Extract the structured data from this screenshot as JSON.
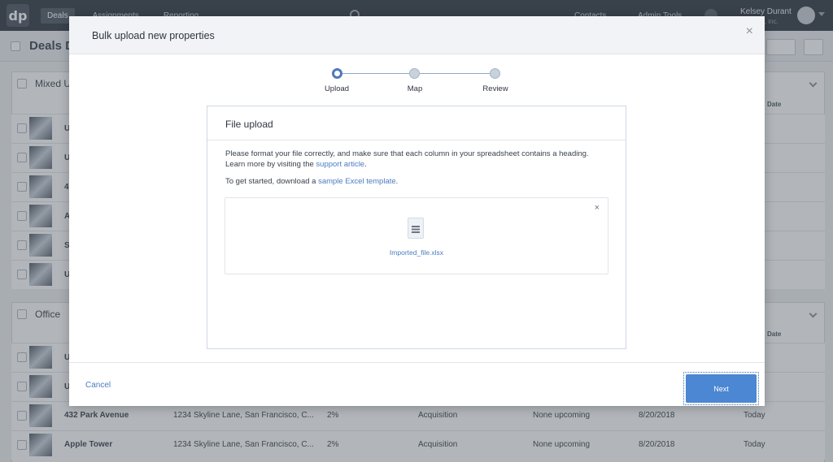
{
  "app": {
    "logo": "dp",
    "nav": [
      "Deals",
      "Assignments",
      "Reporting"
    ],
    "top_links": [
      "Contacts",
      "Admin Tools"
    ],
    "user": {
      "name": "Kelsey Durant",
      "org": "...ath, inc."
    },
    "page_title": "Deals D..."
  },
  "sections": [
    {
      "title": "Mixed U...",
      "col_date": "Date",
      "rows": [
        {
          "name": "U",
          "address": "",
          "pct": "",
          "type": "",
          "upcoming": "",
          "date": "",
          "updated": ""
        },
        {
          "name": "U",
          "address": "",
          "pct": "",
          "type": "",
          "upcoming": "",
          "date": "",
          "updated": ""
        },
        {
          "name": "4",
          "address": "",
          "pct": "",
          "type": "",
          "upcoming": "",
          "date": "",
          "updated": ""
        },
        {
          "name": "A",
          "address": "",
          "pct": "",
          "type": "",
          "upcoming": "",
          "date": "",
          "updated": ""
        },
        {
          "name": "S",
          "address": "",
          "pct": "",
          "type": "",
          "upcoming": "",
          "date": "",
          "updated": ""
        },
        {
          "name": "U",
          "address": "",
          "pct": "",
          "type": "",
          "upcoming": "",
          "date": "",
          "updated": ""
        }
      ]
    },
    {
      "title": "Office",
      "col_date": "Date",
      "rows": [
        {
          "name": "U",
          "address": "",
          "pct": "",
          "type": "",
          "upcoming": "",
          "date": "",
          "updated": ""
        },
        {
          "name": "U",
          "address": "",
          "pct": "",
          "type": "",
          "upcoming": "",
          "date": "",
          "updated": ""
        },
        {
          "name": "432 Park Avenue",
          "address": "1234 Skyline Lane, San Francisco, C...",
          "pct": "2%",
          "type": "Acquisition",
          "upcoming": "None upcoming",
          "date": "8/20/2018",
          "updated": "Today"
        },
        {
          "name": "Apple Tower",
          "address": "1234 Skyline Lane, San Francisco, C...",
          "pct": "2%",
          "type": "Acquisition",
          "upcoming": "None upcoming",
          "date": "8/20/2018",
          "updated": "Today"
        }
      ]
    }
  ],
  "modal": {
    "title": "Bulk upload new properties",
    "close_icon": "close-icon",
    "steps": [
      {
        "label": "Upload",
        "active": true
      },
      {
        "label": "Map",
        "active": false
      },
      {
        "label": "Review",
        "active": false
      }
    ],
    "card": {
      "title": "File upload",
      "paragraph1": "Please format your file correctly, and make sure that each column in your spreadsheet contains a heading.",
      "paragraph1b_prefix": "Learn more by visiting the ",
      "paragraph1b_link": "support article",
      "paragraph1b_suffix": ".",
      "paragraph2_prefix": "To get started, download a ",
      "paragraph2_link": "sample Excel template",
      "paragraph2_suffix": ".",
      "file_name": "Imported_file.xlsx",
      "remove_icon": "×"
    },
    "footer": {
      "cancel": "Cancel",
      "next": "Next"
    }
  },
  "colors": {
    "accent": "#4b87d2",
    "link": "#4a7cc3",
    "topbar": "#2f3640"
  }
}
